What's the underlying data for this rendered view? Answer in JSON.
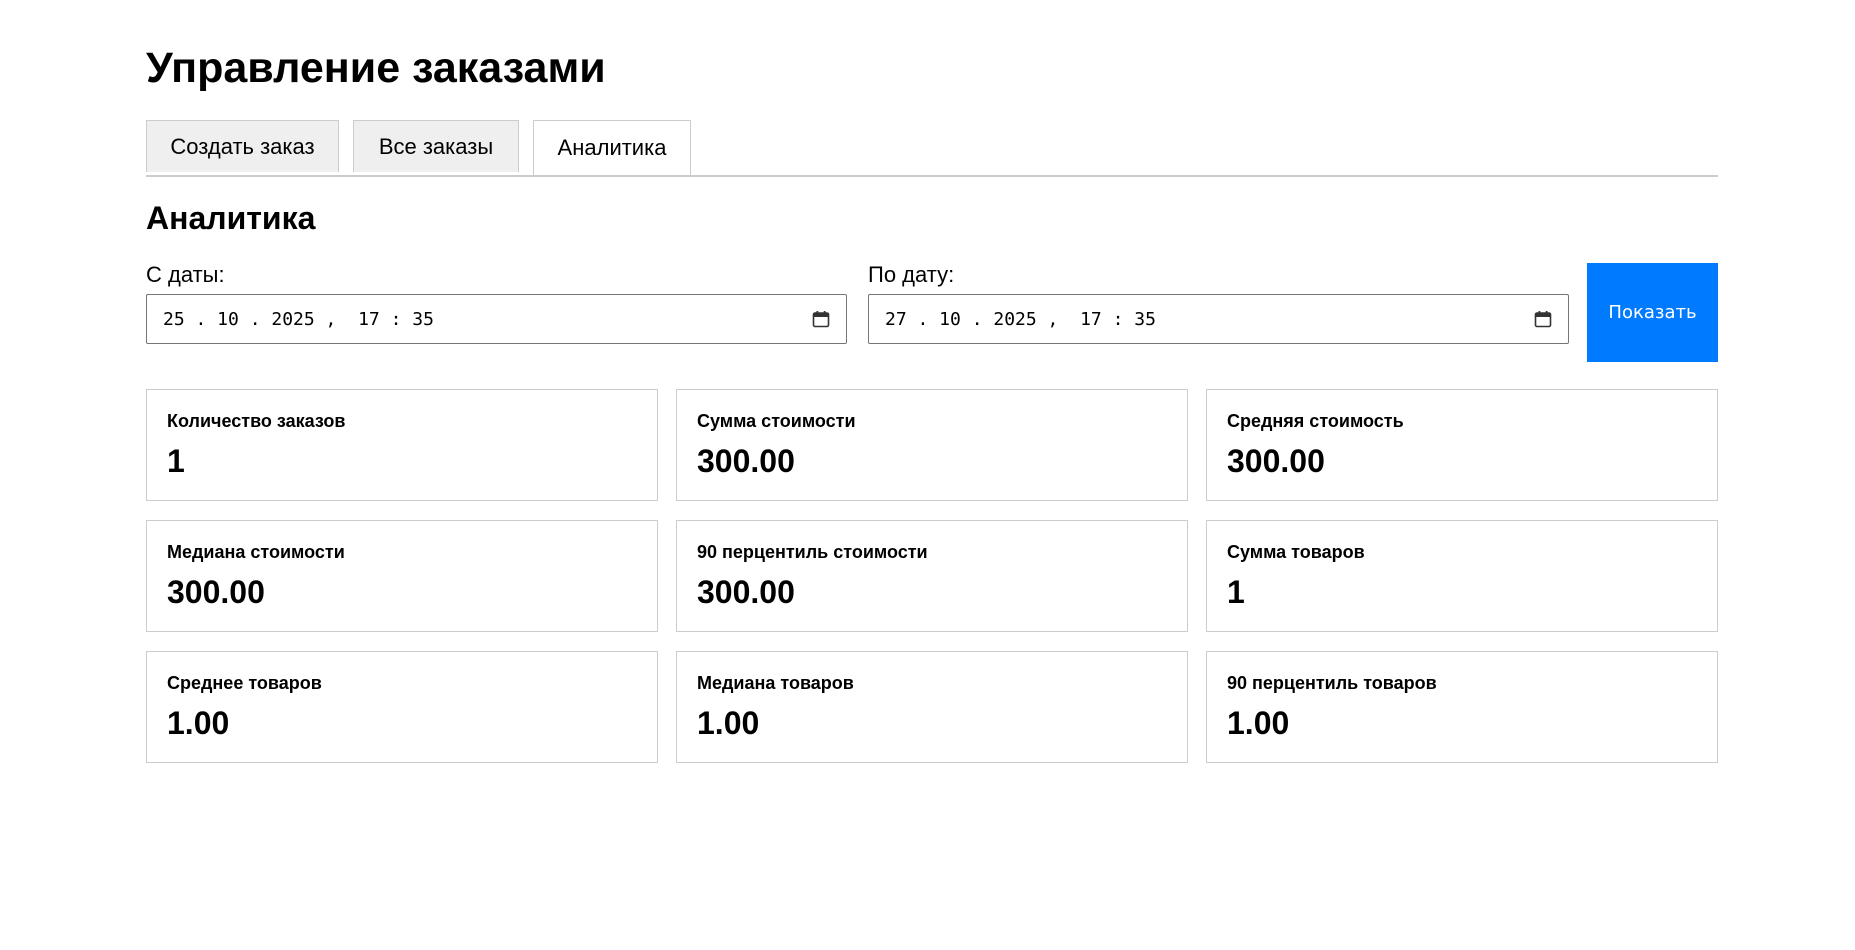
{
  "page": {
    "title": "Управление заказами"
  },
  "tabs": [
    {
      "label": "Создать заказ",
      "active": false
    },
    {
      "label": "Все заказы",
      "active": false
    },
    {
      "label": "Аналитика",
      "active": true
    }
  ],
  "analytics": {
    "title": "Аналитика",
    "from": {
      "label": "С даты:",
      "value": "25 . 10 . 2025 ,  17 : 35",
      "icon": "calendar-icon"
    },
    "to": {
      "label": "По дату:",
      "value": "27 . 10 . 2025 ,  17 : 35",
      "icon": "calendar-icon"
    },
    "show_button": "Показать",
    "accent_color": "#007bff",
    "cards": [
      {
        "label": "Количество заказов",
        "value": "1"
      },
      {
        "label": "Сумма стоимости",
        "value": "300.00"
      },
      {
        "label": "Средняя стоимость",
        "value": "300.00"
      },
      {
        "label": "Медиана стоимости",
        "value": "300.00"
      },
      {
        "label": "90 перцентиль стоимости",
        "value": "300.00"
      },
      {
        "label": "Сумма товаров",
        "value": "1"
      },
      {
        "label": "Среднее товаров",
        "value": "1.00"
      },
      {
        "label": "Медиана товаров",
        "value": "1.00"
      },
      {
        "label": "90 перцентиль товаров",
        "value": "1.00"
      }
    ]
  }
}
